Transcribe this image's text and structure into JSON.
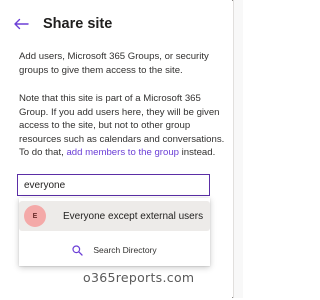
{
  "header": {
    "title": "Share site"
  },
  "intro": "Add users, Microsoft 365 Groups, or security groups to give them access to the site.",
  "note": {
    "text_before": "Note that this site is part of a Microsoft 365 Group. If you add users here, they will be given access to the site, but not to other group resources such as calendars and conversations. To do that, ",
    "link": "add members to the group",
    "text_after": " instead."
  },
  "search": {
    "value": "everyone"
  },
  "suggestions": [
    {
      "initials": "E",
      "label": "Everyone except external users"
    }
  ],
  "search_directory": {
    "label": "Search Directory"
  },
  "colors": {
    "accent": "#6b3fd6",
    "avatar": "#f4a9a8",
    "highlight": "#edebe9"
  },
  "icons": {
    "back": "back-arrow-icon",
    "search": "search-icon"
  },
  "watermark": "o365reports.com"
}
